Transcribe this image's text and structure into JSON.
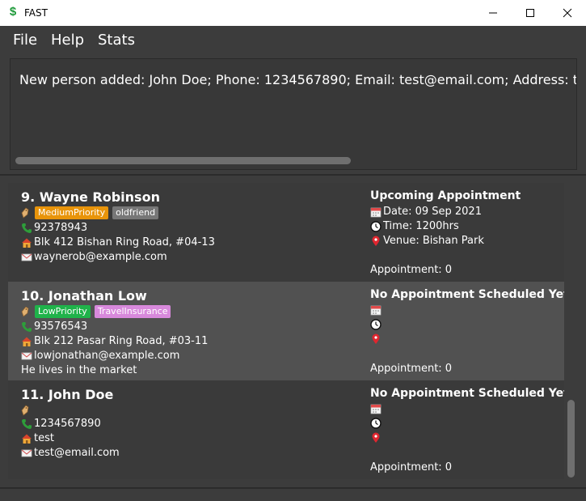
{
  "window": {
    "title": "FAST",
    "app_icon": "$"
  },
  "menu": [
    "File",
    "Help",
    "Stats"
  ],
  "result": {
    "message": "New person added: John Doe; Phone: 1234567890; Email: test@email.com; Address: test"
  },
  "persons": [
    {
      "index_name": "9.  Wayne Robinson",
      "tags": [
        {
          "label": "MediumPriority",
          "color": "#e8940a"
        },
        {
          "label": "oldfriend",
          "color": "#777777"
        }
      ],
      "phone": "92378943",
      "address": "Blk 412 Bishan Ring Road, #04-13",
      "email": "waynerob@example.com",
      "remark": "",
      "appointment": {
        "title": "Upcoming Appointment",
        "date": "Date: 09 Sep 2021",
        "time": "Time: 1200hrs",
        "venue": "Venue: Bishan Park",
        "count": "Appointment: 0"
      }
    },
    {
      "index_name": "10.  Jonathan Low",
      "tags": [
        {
          "label": "LowPriority",
          "color": "#1fb34a"
        },
        {
          "label": "TravelInsurance",
          "color": "#d889dc"
        }
      ],
      "phone": "93576543",
      "address": "Blk 212 Pasar Ring Road, #03-11",
      "email": "lowjonathan@example.com",
      "remark": "He lives in the market",
      "appointment": {
        "title": "No Appointment Scheduled Yet",
        "date": "",
        "time": "",
        "venue": "",
        "count": "Appointment: 0"
      }
    },
    {
      "index_name": "11.  John Doe",
      "tags": [],
      "phone": "1234567890",
      "address": "test",
      "email": "test@email.com",
      "remark": "",
      "appointment": {
        "title": "No Appointment Scheduled Yet",
        "date": "",
        "time": "",
        "venue": "",
        "count": "Appointment: 0"
      }
    }
  ],
  "icons": {
    "tag": "tag-icon",
    "phone": "phone-icon",
    "address": "house-icon",
    "email": "mail-icon",
    "date": "calendar-icon",
    "time": "clock-icon",
    "venue": "location-pin-icon"
  },
  "colors": {
    "background": "#3c3c3c",
    "card_selected": "#515151",
    "phone_icon": "#2e9e3a",
    "pin_icon": "#e0262f"
  }
}
